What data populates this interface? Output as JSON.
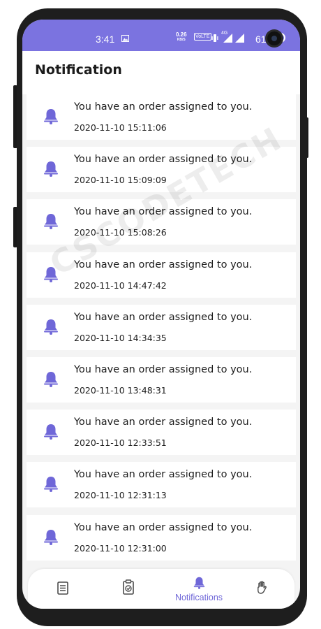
{
  "status_bar": {
    "time": "3:41",
    "speed_value": "0.26",
    "speed_unit": "KB/S",
    "volte": "VoLTE",
    "network": "4G",
    "battery": "61"
  },
  "header": {
    "title": "Notification"
  },
  "notifications": [
    {
      "message": "You have an order assigned to you.",
      "time": "2020-11-10 15:11:06"
    },
    {
      "message": "You have an order assigned to you.",
      "time": "2020-11-10 15:09:09"
    },
    {
      "message": "You have an order assigned to you.",
      "time": "2020-11-10 15:08:26"
    },
    {
      "message": "You have an order assigned to you.",
      "time": "2020-11-10 14:47:42"
    },
    {
      "message": "You have an order assigned to you.",
      "time": "2020-11-10 14:34:35"
    },
    {
      "message": "You have an order assigned to you.",
      "time": "2020-11-10 13:48:31"
    },
    {
      "message": "You have an order assigned to you.",
      "time": "2020-11-10 12:33:51"
    },
    {
      "message": "You have an order assigned to you.",
      "time": "2020-11-10 12:31:13"
    },
    {
      "message": "You have an order assigned to you.",
      "time": "2020-11-10 12:31:00"
    }
  ],
  "watermark": "CSCODETECH",
  "bottom_nav": {
    "items": [
      {
        "icon": "orders-list-icon"
      },
      {
        "icon": "clipboard-check-icon"
      },
      {
        "icon": "bell-icon",
        "label": "Notifications",
        "active": true
      },
      {
        "icon": "hand-icon"
      }
    ]
  },
  "colors": {
    "accent": "#7b73e0",
    "bell": "#6f67d8",
    "text": "#1d1d1d",
    "background": "#f4f4f4"
  }
}
